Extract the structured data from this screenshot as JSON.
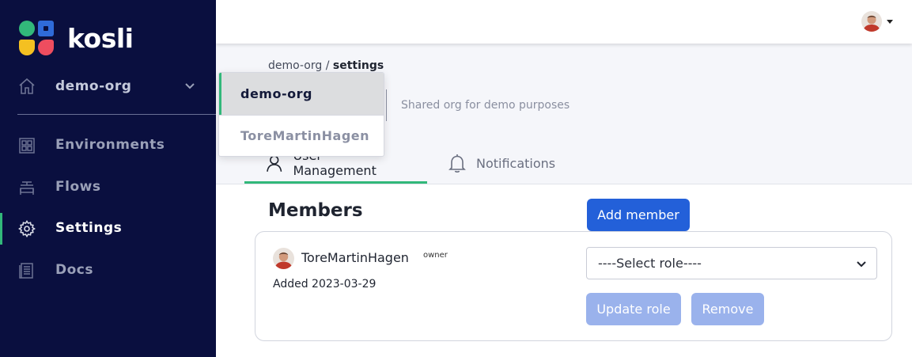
{
  "app": {
    "brand": "kosli"
  },
  "colors": {
    "sidebar_bg": "#0a0f3f",
    "accent_green": "#32b87a",
    "primary_blue": "#2360d9"
  },
  "sidebar": {
    "org_name": "demo-org",
    "items": [
      {
        "label": "Environments",
        "icon": "environments-icon"
      },
      {
        "label": "Flows",
        "icon": "flows-icon"
      },
      {
        "label": "Settings",
        "icon": "gear-icon",
        "active": true
      },
      {
        "label": "Docs",
        "icon": "docs-icon"
      }
    ]
  },
  "header": {
    "avatar_alt": "user-avatar"
  },
  "breadcrumb": {
    "org": "demo-org",
    "separator": "/",
    "current": "settings"
  },
  "org": {
    "description": "Shared org for demo purposes"
  },
  "org_menu": {
    "options": [
      {
        "label": "demo-org",
        "selected": true
      },
      {
        "label": "ToreMartinHagen",
        "selected": false
      }
    ]
  },
  "tabs": [
    {
      "label": "User Management",
      "active": true
    },
    {
      "label": "Notifications",
      "active": false
    }
  ],
  "members": {
    "title": "Members",
    "add_label": "Add member",
    "list": [
      {
        "name": "ToreMartinHagen",
        "badge": "owner",
        "added": "Added 2023-03-29",
        "role_placeholder": "----Select role----",
        "update_label": "Update role",
        "remove_label": "Remove"
      }
    ]
  }
}
